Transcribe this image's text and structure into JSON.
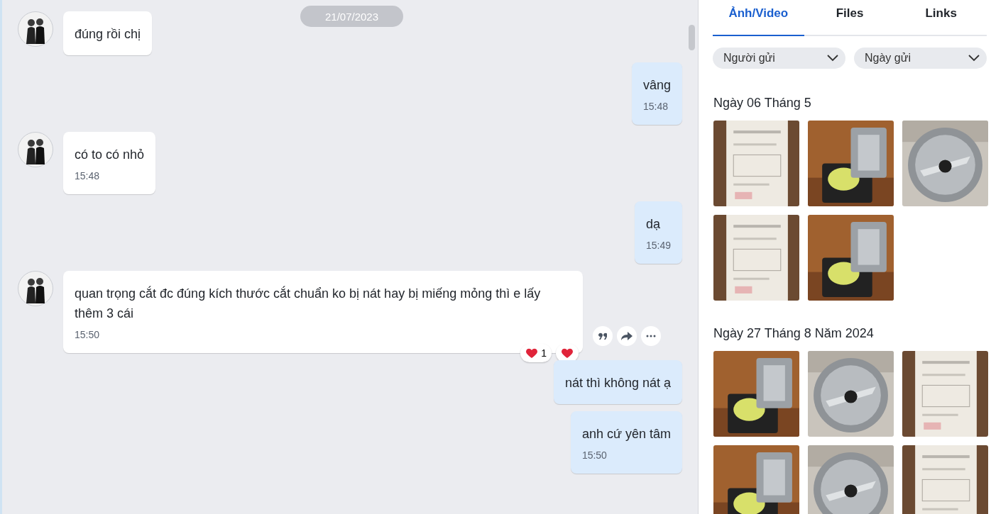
{
  "chat": {
    "date_pill": "21/07/2023",
    "messages": [
      {
        "kind": "received",
        "text": "đúng rồi chị"
      },
      {
        "kind": "sent",
        "text": "vâng",
        "time": "15:48"
      },
      {
        "kind": "received",
        "text": "có to có nhỏ",
        "time": "15:48"
      },
      {
        "kind": "sent",
        "text": "dạ",
        "time": "15:49"
      },
      {
        "kind": "received",
        "text": "quan trọng cắt đc đúng kích thước cắt chuẩn ko bị nát hay bị miếng mỏng thì e lấy thêm 3 cái",
        "time": "15:50",
        "reaction_count": "1",
        "actions": true
      },
      {
        "kind": "sent",
        "text": "nát thì không nát ạ"
      },
      {
        "kind": "sent",
        "text": "anh cứ yên tâm",
        "time": "15:50"
      }
    ]
  },
  "panel": {
    "tabs": [
      {
        "label": "Ảnh/Video",
        "selected": true
      },
      {
        "label": "Files",
        "selected": false
      },
      {
        "label": "Links",
        "selected": false
      }
    ],
    "filters": [
      {
        "label": "Người gửi"
      },
      {
        "label": "Ngày gửi"
      }
    ],
    "sections": [
      {
        "title": "Ngày 06 Tháng 5"
      },
      {
        "title": "Ngày 27 Tháng 8 Năm 2024"
      }
    ]
  }
}
